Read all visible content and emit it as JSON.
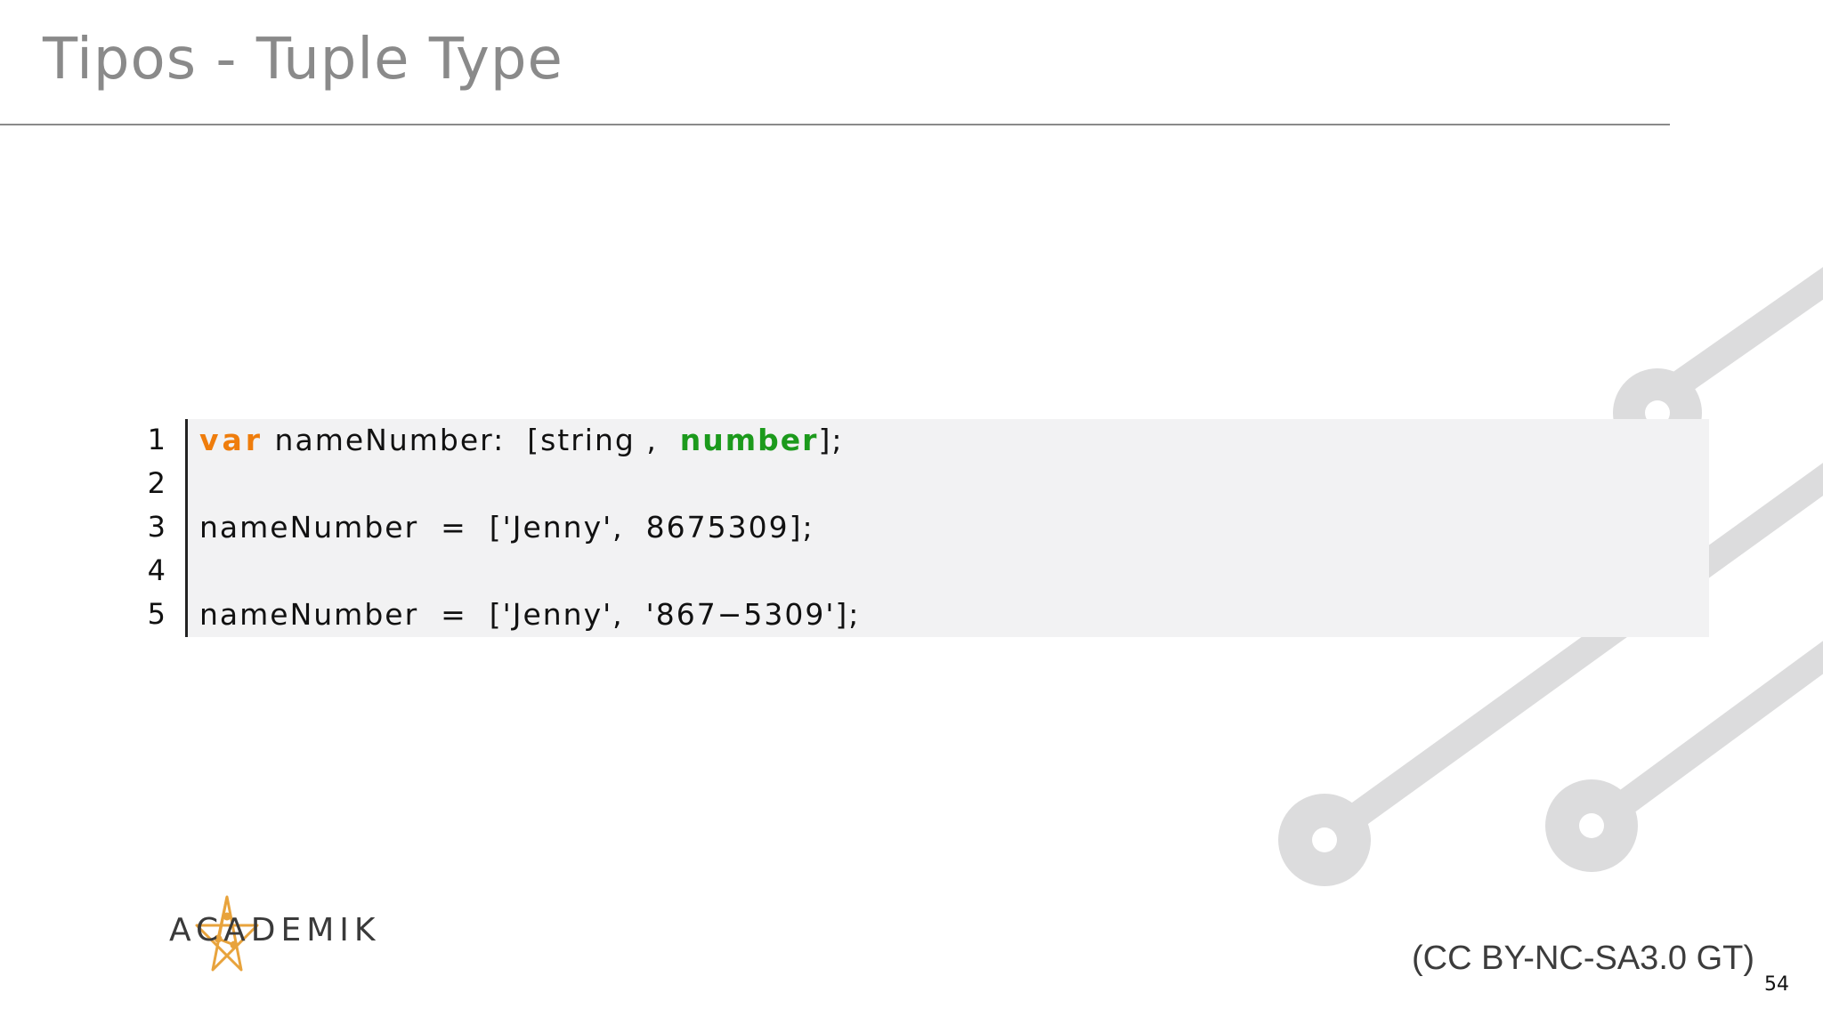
{
  "slide": {
    "title": "Tipos - Tuple Type",
    "page_number": "54",
    "license": "(CC BY-NC-SA3.0 GT)"
  },
  "logo": {
    "text": "ACADEMIK",
    "icon": "academik-star-icon",
    "color": "#e8a33c"
  },
  "code": {
    "line_numbers": [
      "1",
      "2",
      "3",
      "4",
      "5"
    ],
    "line1": {
      "keyword": "var",
      "name": " nameNumber:  [string ,  ",
      "type": "number",
      "end": "];"
    },
    "line3": "nameNumber  =  ['Jenny',  8675309];",
    "line5": "nameNumber  =  ['Jenny',  '867−5309'];"
  },
  "colors": {
    "title": "#8a8a8a",
    "keyword": "#ef7d0c",
    "type": "#1c9a1c",
    "code_bg": "#f2f2f3",
    "decoration": "#dcdcdd"
  }
}
